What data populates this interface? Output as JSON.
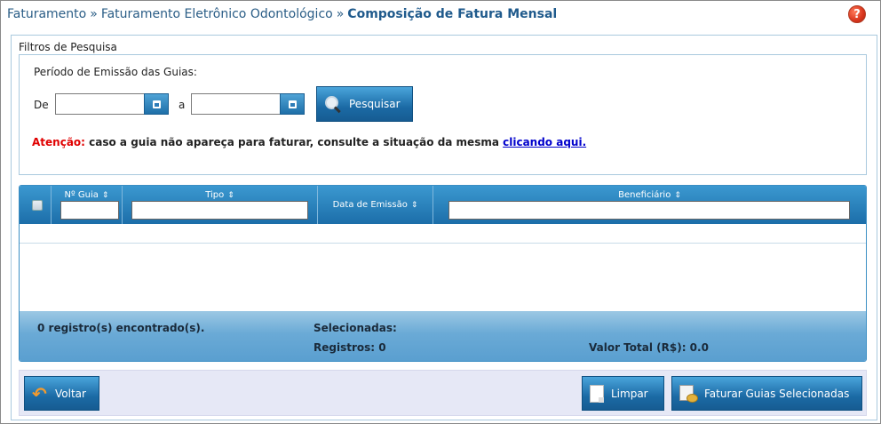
{
  "breadcrumb": {
    "items": [
      "Faturamento",
      "Faturamento Eletrônico Odontológico"
    ],
    "current": "Composição de Fatura Mensal",
    "separator": "»"
  },
  "help": {
    "label": "?"
  },
  "filters": {
    "title": "Filtros de Pesquisa",
    "period_label": "Período de Emissão das Guias:",
    "from_label": "De",
    "to_label": "a",
    "from_value": "",
    "to_value": "",
    "search_label": "Pesquisar"
  },
  "attention": {
    "label": "Atenção:",
    "message": " caso a guia não apareça para faturar, consulte a situação da mesma ",
    "link": "clicando aqui."
  },
  "grid": {
    "columns": {
      "guia": "Nº Guia",
      "tipo": "Tipo",
      "data": "Data de Emissão",
      "beneficiario": "Beneficiário"
    },
    "sort_glyph": "⇕",
    "footer": {
      "count": "0 registro(s) encontrado(s).",
      "selected_label": "Selecionadas:",
      "records": "Registros: 0",
      "total": "Valor Total (R$): 0.0"
    }
  },
  "actions": {
    "back": "Voltar",
    "clear": "Limpar",
    "invoice": "Faturar Guias Selecionadas"
  },
  "colors": {
    "accent": "#1c6ea9",
    "breadcrumb": "#2a5d86",
    "warning": "#e00000",
    "link": "#0000cc"
  }
}
